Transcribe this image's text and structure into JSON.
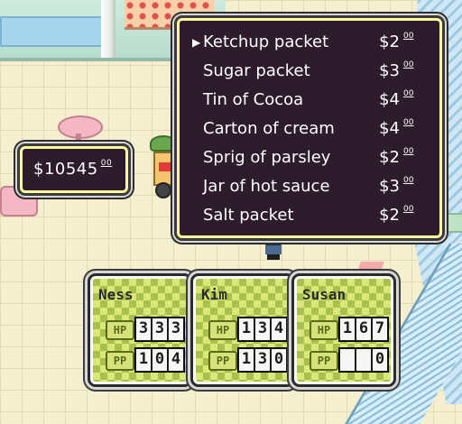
{
  "money": {
    "dollar_prefix": "$",
    "amount": "10545",
    "cents": "00"
  },
  "shop": {
    "selected_index": 0,
    "items": [
      {
        "name": "Ketchup packet",
        "price": "$2",
        "cents": "00"
      },
      {
        "name": "Sugar packet",
        "price": "$3",
        "cents": "00"
      },
      {
        "name": "Tin of Cocoa",
        "price": "$4",
        "cents": "00"
      },
      {
        "name": "Carton of cream",
        "price": "$4",
        "cents": "00"
      },
      {
        "name": "Sprig of parsley",
        "price": "$2",
        "cents": "00"
      },
      {
        "name": "Jar of hot sauce",
        "price": "$3",
        "cents": "00"
      },
      {
        "name": "Salt packet",
        "price": "$2",
        "cents": "00"
      }
    ]
  },
  "party": [
    {
      "name": "Ness",
      "hp_label": "HP",
      "hp": [
        "3",
        "3",
        "3"
      ],
      "pp_label": "PP",
      "pp": [
        "1",
        "0",
        "4"
      ]
    },
    {
      "name": "Kim",
      "hp_label": "HP",
      "hp": [
        "1",
        "3",
        "4"
      ],
      "pp_label": "PP",
      "pp": [
        "1",
        "3",
        "0"
      ]
    },
    {
      "name": "Susan",
      "hp_label": "HP",
      "hp": [
        "1",
        "6",
        "7"
      ],
      "pp_label": "PP",
      "pp": [
        "",
        "",
        "0"
      ]
    }
  ],
  "colors": {
    "window_bg": "#2d1c2c",
    "window_border": "#ffffa0",
    "status_check_light": "#d9e876",
    "status_check_dark": "#aac04e"
  },
  "icons": {
    "cursor": "▶"
  }
}
